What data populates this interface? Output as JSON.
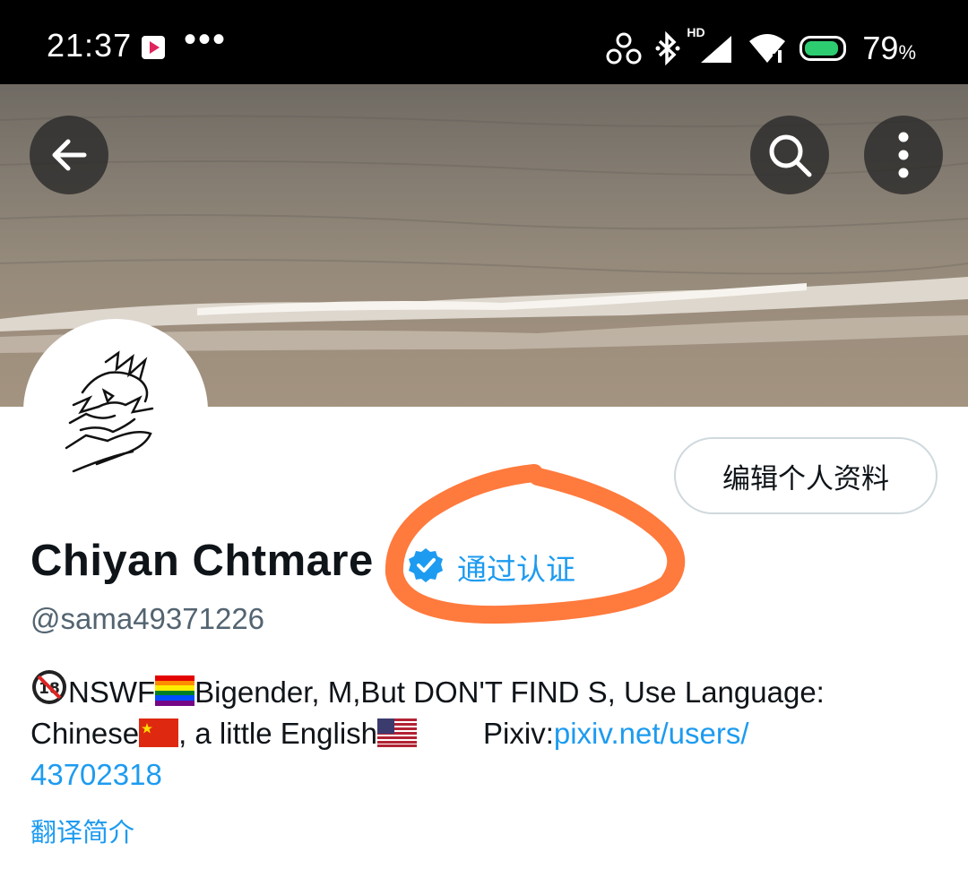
{
  "status_bar": {
    "time": "21:37",
    "more": "•••",
    "network": "HD",
    "battery_percent": "79",
    "battery_unit": "%",
    "battery_level": 0.79,
    "icons": [
      "video-app-icon",
      "hotspot-icon",
      "bluetooth-icon",
      "signal-icon",
      "wifi-icon",
      "battery-icon"
    ]
  },
  "header": {
    "back_icon": "arrow-left-icon",
    "search_icon": "search-icon",
    "more_icon": "more-vertical-icon"
  },
  "profile": {
    "edit_button": "编辑个人资料",
    "name": "Chiyan Chtmare",
    "verified_label": "通过认证",
    "handle": "@sama49371226",
    "bio_part1": "NSWF",
    "bio_part2": "Bigender, M,But DON'T FIND S, Use Language:",
    "bio_part3": "Chinese",
    "bio_part4": ", a little English",
    "bio_part5": "Pixiv:",
    "bio_link": "pixiv.net/users/",
    "bio_link_cont": "43702318",
    "translate": "翻译简介"
  },
  "colors": {
    "accent": "#1d9bf0",
    "text": "#0f1419",
    "secondary": "#536471",
    "annotation": "#ff7a3d"
  }
}
